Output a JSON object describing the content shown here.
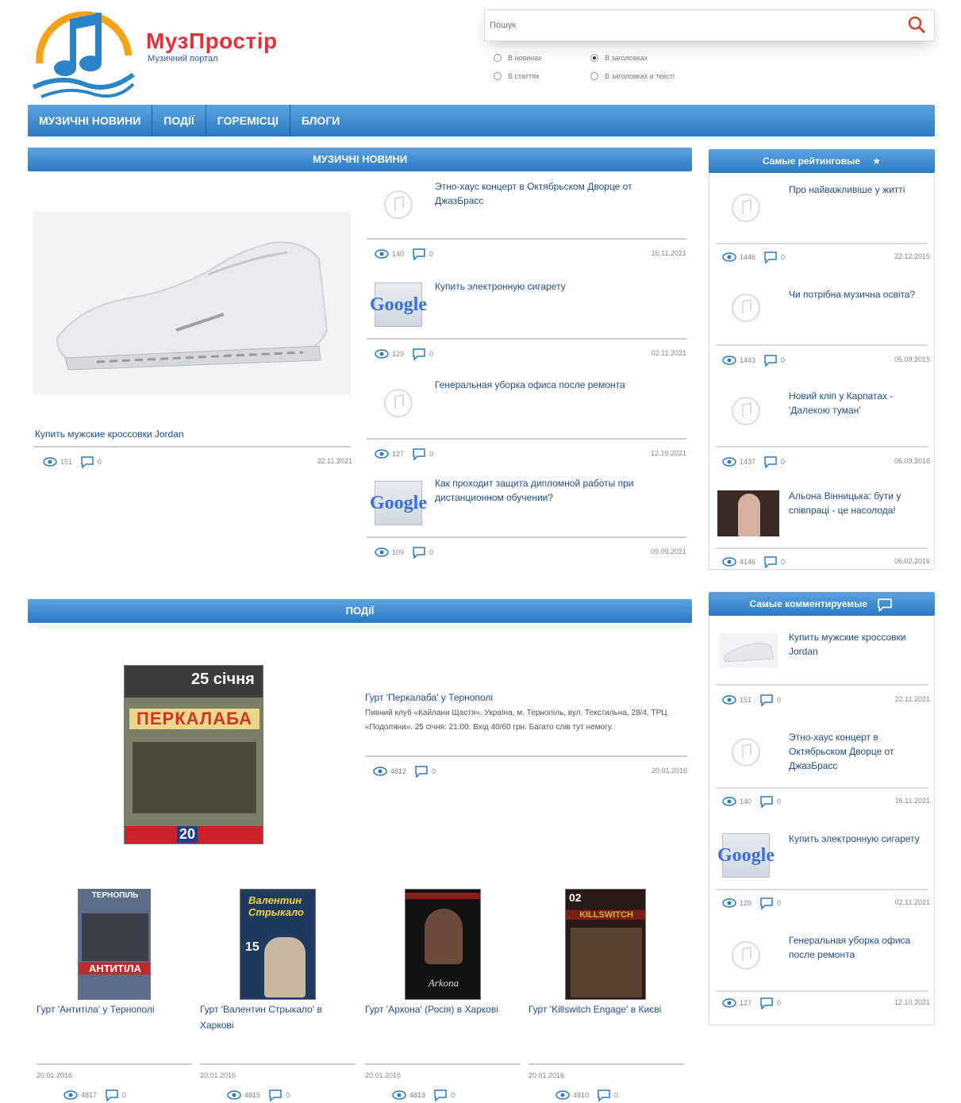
{
  "site": {
    "brand": "МузПростір",
    "tagline": "Музичний портал"
  },
  "search": {
    "placeholder": "Пошук",
    "options": [
      "В новинах",
      "В статтях",
      "В заголовках",
      "В заголовках и тексті"
    ]
  },
  "nav": {
    "items": [
      "МУЗИЧНІ НОВИНИ",
      "ПОДІЇ",
      "ГОРЕМІСЦІ",
      "БЛОГИ"
    ]
  },
  "news": {
    "heading": "МУЗИЧНІ НОВИНИ",
    "featured": {
      "title": "Купить мужские кроссовки Jordan",
      "views": "151",
      "comments": "0",
      "date": "22.11.2021"
    },
    "items": [
      {
        "title": "Этно-хаус концерт в Октябрьском Дворце от ДжазБрасс",
        "views": "140",
        "comments": "0",
        "date": "16.11.2021"
      },
      {
        "title": "Купить электронную сигарету",
        "views": "129",
        "comments": "0",
        "date": "02.11.2021"
      },
      {
        "title": "Генеральная уборка офиса после ремонта",
        "views": "127",
        "comments": "0",
        "date": "12.10.2021"
      },
      {
        "title": "Как проходит защита дипломной работы при дистанционном обучении?",
        "views": "109",
        "comments": "0",
        "date": "09.09.2021"
      }
    ]
  },
  "events": {
    "heading": "ПОДІЇ",
    "featured": {
      "title": "Гурт 'Перкалаба' у Тернополі",
      "text": "Пивний клуб «Кайлани Щастя». Україна, м. Тернопіль, вул. Текстильна, 28/4, ТРЦ «Подоляни». 25 січня. 21:00. Вхід 40/60 грн. Багато слів тут немогу.",
      "poster_date": "25 січня",
      "poster_band": "ПЕРКАЛАБА",
      "poster_price": "20",
      "views": "4812",
      "comments": "0",
      "date": "20.01.2016"
    },
    "cards": [
      {
        "title": "Гурт 'Антитіла' у Тернополі",
        "date": "20.01.2016",
        "views": "4817",
        "comments": "0",
        "poster_text": "АНТИТІЛА",
        "poster_top": "ТЕРНОПІЛЬ"
      },
      {
        "title": "Гурт 'Валентин Стрыкало' в Харкові",
        "date": "20.01.2016",
        "views": "4815",
        "comments": "0",
        "poster_text": "Валентин Стрыкало",
        "poster_top": "15"
      },
      {
        "title": "Гурт 'Архона' (Росія) в Харкові",
        "date": "20.01.2016",
        "views": "4813",
        "comments": "0",
        "poster_text": "Arkona",
        "poster_top": ""
      },
      {
        "title": "Гурт 'Killswitch Engage' в Києві",
        "date": "20.01.2016",
        "views": "4810",
        "comments": "0",
        "poster_text": "KILLSWITCH",
        "poster_top": "02"
      }
    ]
  },
  "top_rated": {
    "heading": "Самые рейтинговые",
    "items": [
      {
        "title": "Про найважливіше у житті",
        "views": "1446",
        "comments": "0",
        "date": "22.12.2015"
      },
      {
        "title": "Чи потрібна музична освіта?",
        "views": "1443",
        "comments": "0",
        "date": "05.09.2015"
      },
      {
        "title": "Новий кліп у Карпатах - 'Далекою туман'",
        "views": "1437",
        "comments": "0",
        "date": "06.09.2016"
      },
      {
        "title": "Альона Вінницька: бути у співпраці - це насолода!",
        "views": "4146",
        "comments": "0",
        "date": "06.02.2016"
      }
    ]
  },
  "most_commented": {
    "heading": "Самые комментируемые",
    "items": [
      {
        "title": "Купить мужские кроссовки Jordan",
        "views": "151",
        "comments": "0",
        "date": "22.11.2021"
      },
      {
        "title": "Этно-хаус концерт в Октябрьском Дворце от ДжазБрасс",
        "views": "140",
        "comments": "0",
        "date": "16.11.2021"
      },
      {
        "title": "Купить электронную сигарету",
        "views": "129",
        "comments": "0",
        "date": "02.11.2021"
      },
      {
        "title": "Генеральная уборка офиса после ремонта",
        "views": "127",
        "comments": "0",
        "date": "12.10.2021"
      }
    ]
  },
  "google_text": "Google",
  "colors": {
    "accent": "#2a7bc4",
    "brand_red": "#e0323a",
    "link": "#1f4f8a"
  }
}
